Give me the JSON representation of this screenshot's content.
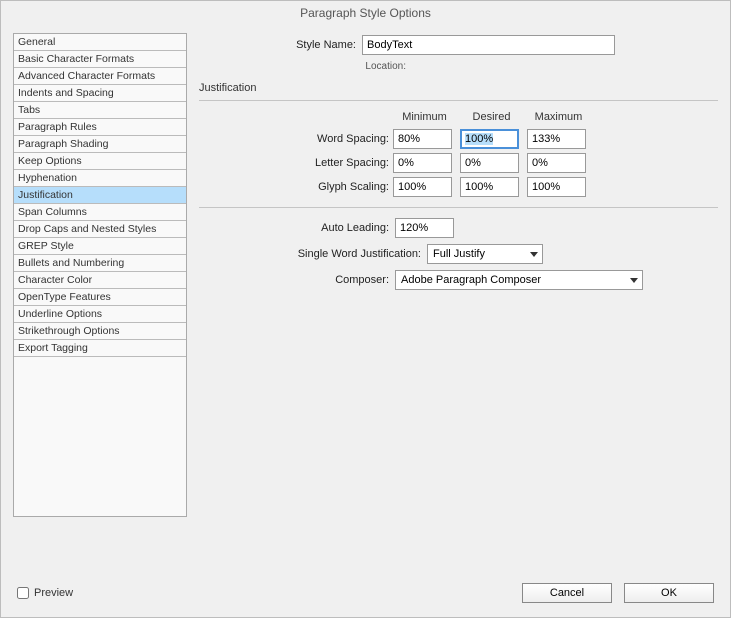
{
  "title": "Paragraph Style Options",
  "sidebar": {
    "items": [
      "General",
      "Basic Character Formats",
      "Advanced Character Formats",
      "Indents and Spacing",
      "Tabs",
      "Paragraph Rules",
      "Paragraph Shading",
      "Keep Options",
      "Hyphenation",
      "Justification",
      "Span Columns",
      "Drop Caps and Nested Styles",
      "GREP Style",
      "Bullets and Numbering",
      "Character Color",
      "OpenType Features",
      "Underline Options",
      "Strikethrough Options",
      "Export Tagging"
    ],
    "selected_index": 9
  },
  "header": {
    "style_name_label": "Style Name:",
    "style_name_value": "BodyText",
    "location_label": "Location:"
  },
  "section": {
    "title": "Justification",
    "columns": {
      "min": "Minimum",
      "desired": "Desired",
      "max": "Maximum"
    },
    "rows": {
      "word_spacing": {
        "label": "Word Spacing:",
        "min": "80%",
        "desired": "100%",
        "max": "133%"
      },
      "letter_spacing": {
        "label": "Letter Spacing:",
        "min": "0%",
        "desired": "0%",
        "max": "0%"
      },
      "glyph_scaling": {
        "label": "Glyph Scaling:",
        "min": "100%",
        "desired": "100%",
        "max": "100%"
      }
    },
    "auto_leading": {
      "label": "Auto Leading:",
      "value": "120%"
    },
    "single_word": {
      "label": "Single Word Justification:",
      "value": "Full Justify"
    },
    "composer": {
      "label": "Composer:",
      "value": "Adobe Paragraph Composer"
    }
  },
  "footer": {
    "preview_label": "Preview",
    "preview_checked": false,
    "cancel": "Cancel",
    "ok": "OK"
  }
}
